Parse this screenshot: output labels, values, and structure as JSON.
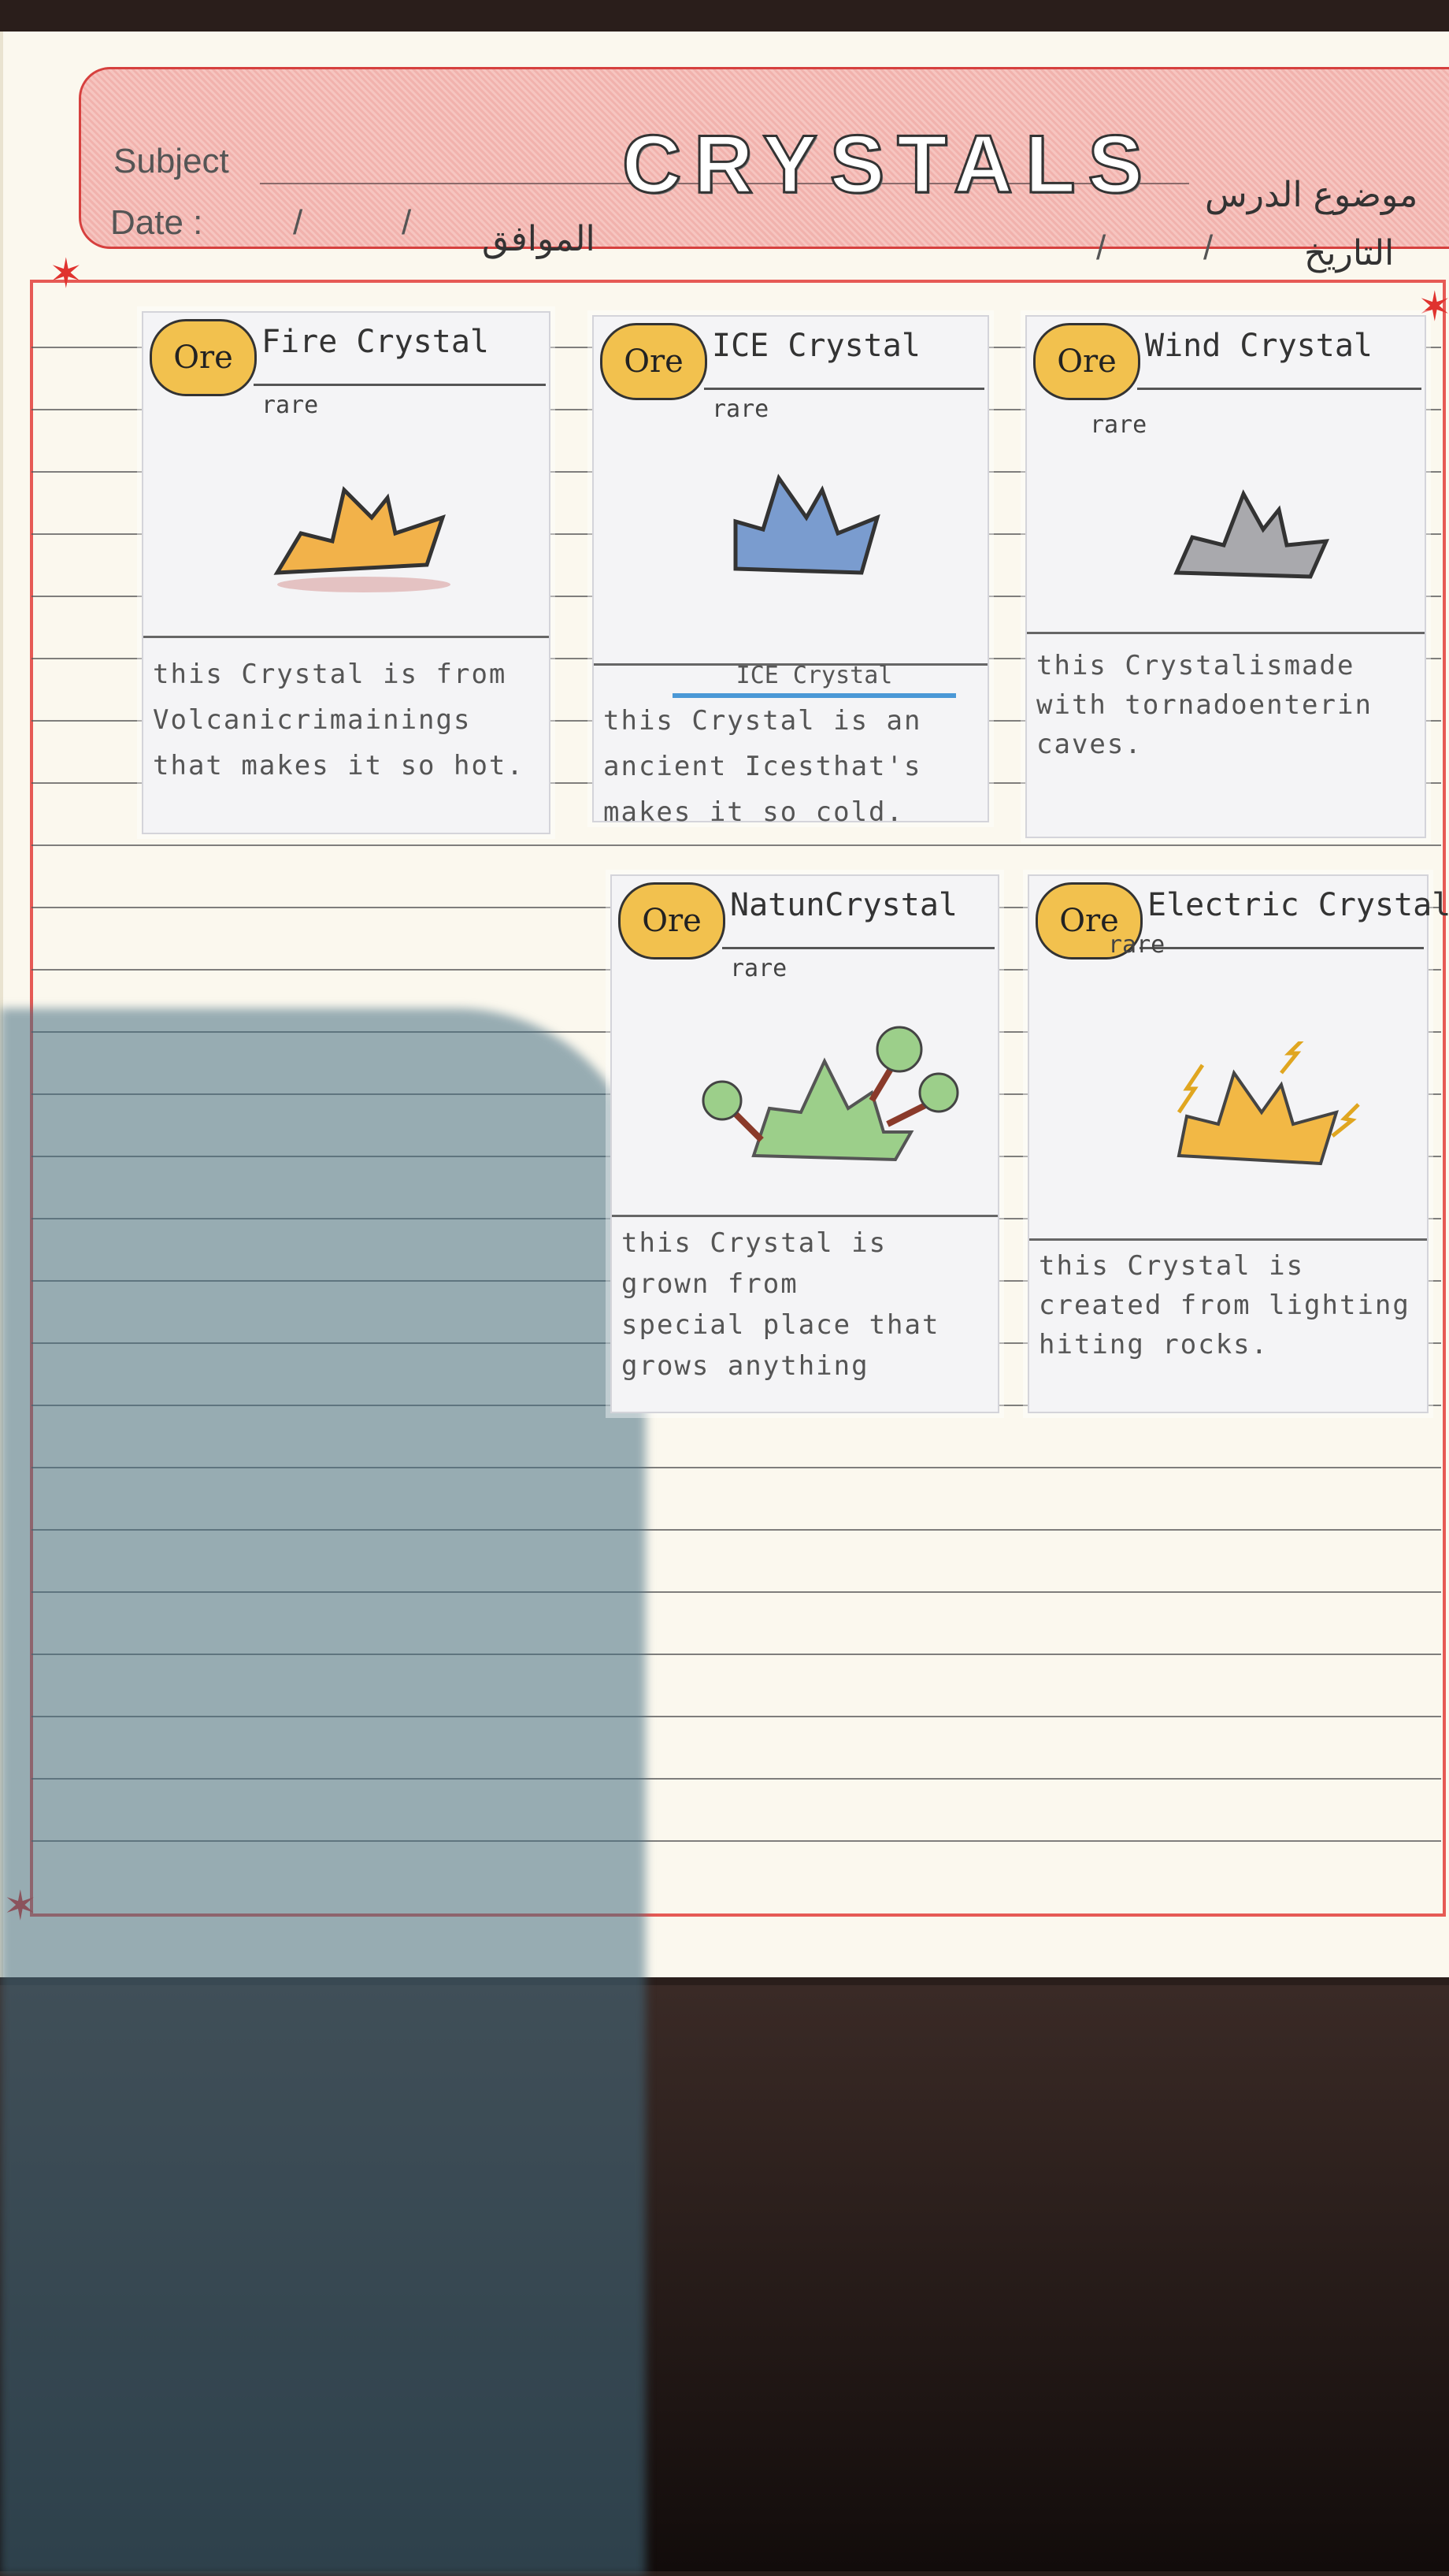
{
  "header": {
    "subject_label": "Subject",
    "date_label": "Date :",
    "title": "CRYSTALS",
    "arabic_subject": "موضوع الدرس",
    "arabic_corresponding": "الموافق",
    "arabic_date": "التاريخ"
  },
  "cards": [
    {
      "badge": "Ore",
      "title": "Fire Crystal",
      "rarity": "rare",
      "desc": [
        "this Crystal is from",
        "Volcanicrimainings",
        "that makes it so hot."
      ],
      "color": "#f2b24a"
    },
    {
      "badge": "Ore",
      "title": "ICE Crystal",
      "rarity": "rare",
      "label": "ICE Crystal",
      "desc": [
        "this Crystal is an",
        "ancient Icesthat's",
        "makes it so cold."
      ],
      "color": "#7a9ccf"
    },
    {
      "badge": "Ore",
      "title": "Wind Crystal",
      "rarity": "rare",
      "desc": [
        "this Crystalismade",
        "with tornadoenterin",
        "caves."
      ],
      "color": "#a9a9ad"
    },
    {
      "badge": "Ore",
      "title": "NatunCrystal",
      "rarity": "rare",
      "desc": [
        "this Crystal is",
        "grown from",
        "special place that",
        "grows anything"
      ],
      "color": "#9ccf8a"
    },
    {
      "badge": "Ore",
      "title": "Electric Crystal",
      "rarity": "rare",
      "desc": [
        "this Crystal is",
        "created from lighting",
        "hiting rocks."
      ],
      "color": "#f2b845"
    }
  ]
}
